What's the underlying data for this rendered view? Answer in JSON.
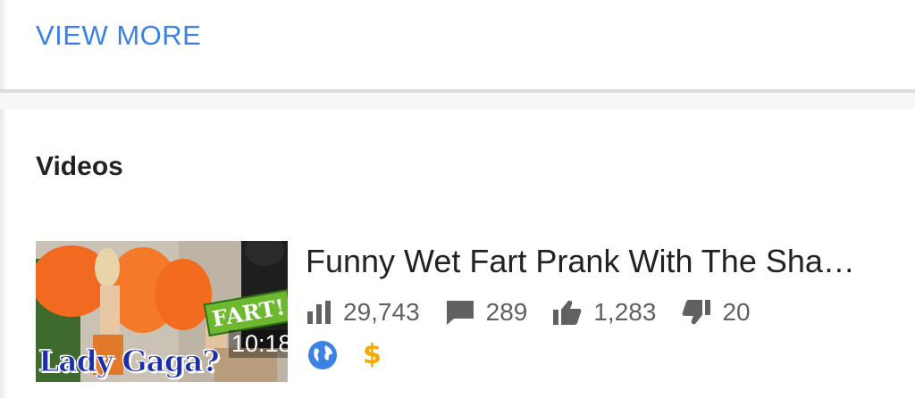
{
  "view_more": {
    "label": "VIEW MORE"
  },
  "videos_section": {
    "title": "Videos",
    "items": [
      {
        "title": "Funny Wet Fart Prank With The Sha…",
        "thumbnail": {
          "caption": "Lady Gaga?",
          "badge": "FART!",
          "duration": "10:18"
        },
        "views": "29,743",
        "comments": "289",
        "likes": "1,283",
        "dislikes": "20",
        "badges": [
          "globe-icon",
          "dollar-icon"
        ],
        "dollar_symbol": "$"
      }
    ]
  },
  "colors": {
    "accent": "#3b82e4",
    "stat_gray": "#616161",
    "globe": "#3b82e4",
    "dollar": "#f2a900"
  }
}
